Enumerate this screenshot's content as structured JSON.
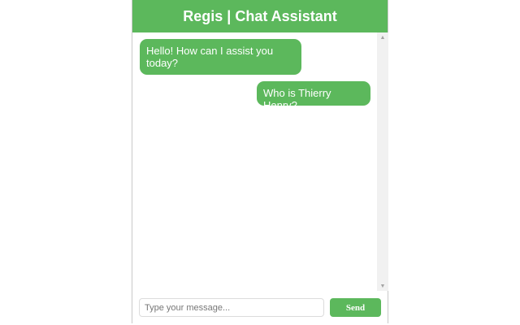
{
  "header": {
    "title": "Regis | Chat Assistant"
  },
  "messages": [
    {
      "sender": "assistant",
      "text": "Hello! How can I assist you today?"
    },
    {
      "sender": "user",
      "text": "Who is Thierry Henry?"
    }
  ],
  "input": {
    "placeholder": "Type your message...",
    "value": ""
  },
  "send_button": {
    "label": "Send"
  },
  "scrollbar": {
    "up_icon": "▲",
    "down_icon": "▼"
  },
  "colors": {
    "accent": "#5cb85c",
    "text_on_accent": "#ffffff",
    "scrollbar_track": "#f1f1f1"
  }
}
